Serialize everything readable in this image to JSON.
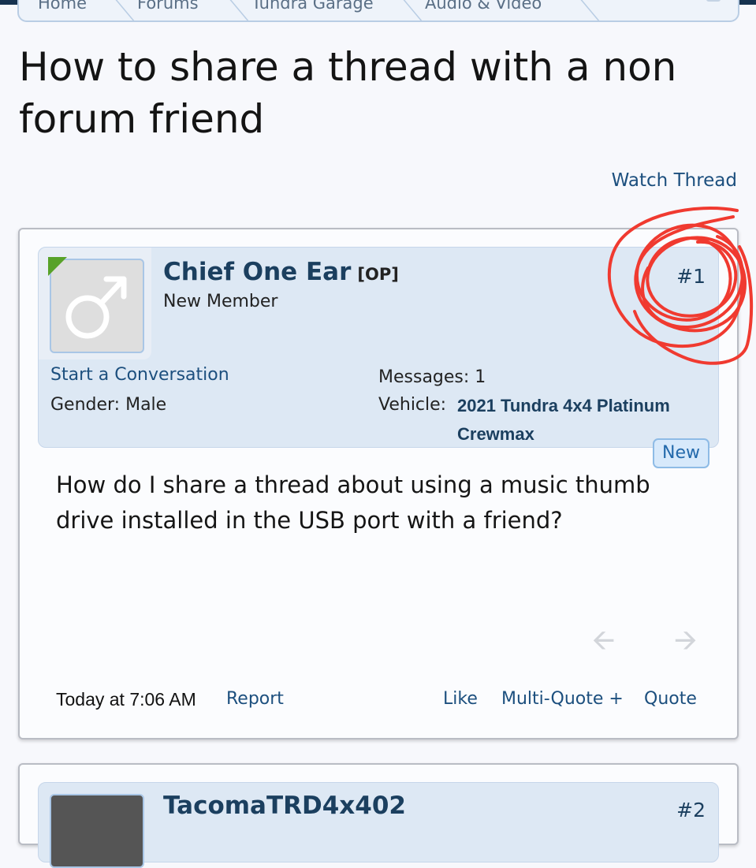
{
  "breadcrumb": {
    "items": [
      "Home",
      "Forums",
      "Tundra Garage",
      "Audio & Video"
    ]
  },
  "thread": {
    "title": "How to share a thread with a non forum friend",
    "watch_label": "Watch Thread"
  },
  "post": {
    "username": "Chief One Ear",
    "op_tag": "[OP]",
    "user_title": "New Member",
    "post_number": "#1",
    "start_conversation": "Start a Conversation",
    "gender": "Gender:  Male",
    "messages": "Messages:  1",
    "vehicle_label": "Vehicle:",
    "vehicle_value": "2021 Tundra 4x4 Platinum Crewmax",
    "new_badge": "New",
    "message": "How do I share a thread about using a music thumb drive installed in the USB port with a friend?",
    "date": "Today at 7:06 AM",
    "report": "Report",
    "like": "Like",
    "multi_quote": "Multi-Quote +",
    "quote": "Quote"
  },
  "post2": {
    "username": "TacomaTRD4x402",
    "post_number": "#2"
  },
  "annotation": {
    "color": "#f03a30"
  },
  "colors": {
    "link": "#1c4f7e",
    "panel": "#dde8f4",
    "online": "#58a229"
  }
}
